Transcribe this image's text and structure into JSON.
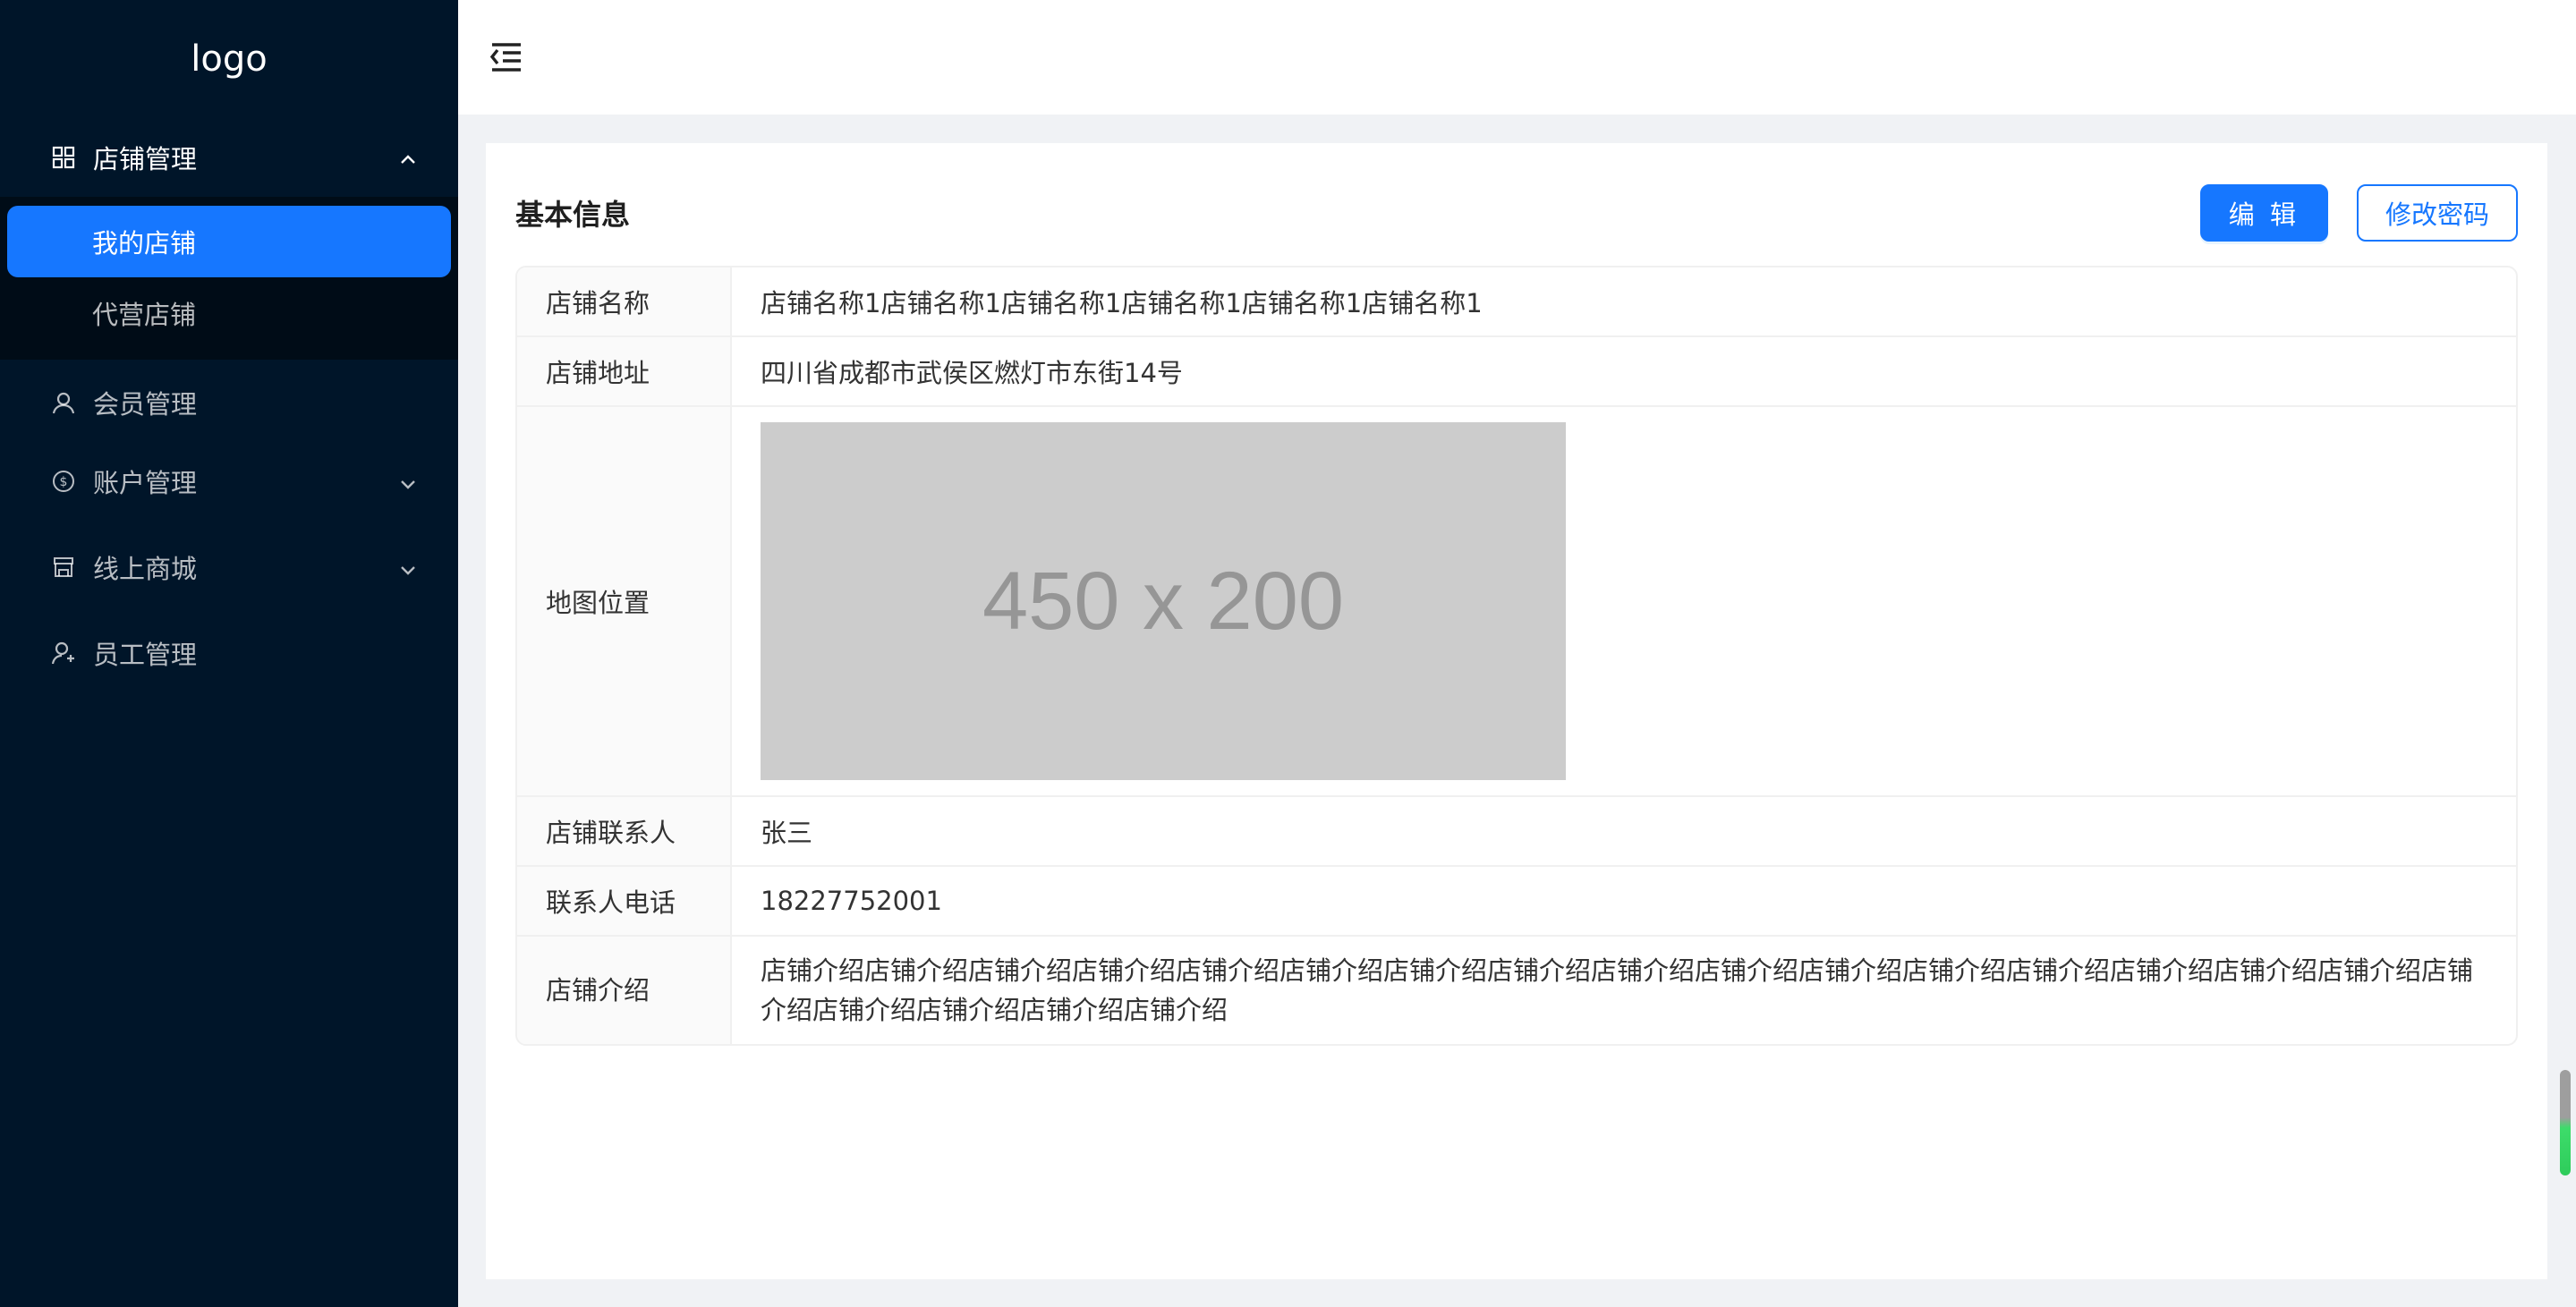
{
  "sidebar": {
    "logo": "logo",
    "menu": [
      {
        "label": "店铺管理",
        "icon": "grid-icon",
        "expanded": true,
        "children": [
          {
            "label": "我的店铺",
            "active": true
          },
          {
            "label": "代营店铺",
            "active": false
          }
        ]
      },
      {
        "label": "会员管理",
        "icon": "user-icon"
      },
      {
        "label": "账户管理",
        "icon": "dollar-circle-icon",
        "expandable": true
      },
      {
        "label": "线上商城",
        "icon": "shop-icon",
        "expandable": true
      },
      {
        "label": "员工管理",
        "icon": "user-add-icon"
      }
    ]
  },
  "header": {
    "toggle_icon": "menu-fold-icon"
  },
  "card": {
    "title": "基本信息",
    "edit_label": "编 辑",
    "change_password_label": "修改密码"
  },
  "details": [
    {
      "label": "店铺名称",
      "value": "店铺名称1店铺名称1店铺名称1店铺名称1店铺名称1店铺名称1"
    },
    {
      "label": "店铺地址",
      "value": "四川省成都市武侯区燃灯市东街14号"
    },
    {
      "label": "地图位置",
      "value": "450 x 200"
    },
    {
      "label": "店铺联系人",
      "value": "张三"
    },
    {
      "label": "联系人电话",
      "value": "18227752001"
    },
    {
      "label": "店铺介绍",
      "value": "店铺介绍店铺介绍店铺介绍店铺介绍店铺介绍店铺介绍店铺介绍店铺介绍店铺介绍店铺介绍店铺介绍店铺介绍店铺介绍店铺介绍店铺介绍店铺介绍店铺介绍店铺介绍店铺介绍店铺介绍店铺介绍"
    }
  ],
  "colors": {
    "sidebar_bg": "#001529",
    "submenu_bg": "#000c17",
    "primary": "#1677ff",
    "placeholder_bg": "#cccccc"
  }
}
